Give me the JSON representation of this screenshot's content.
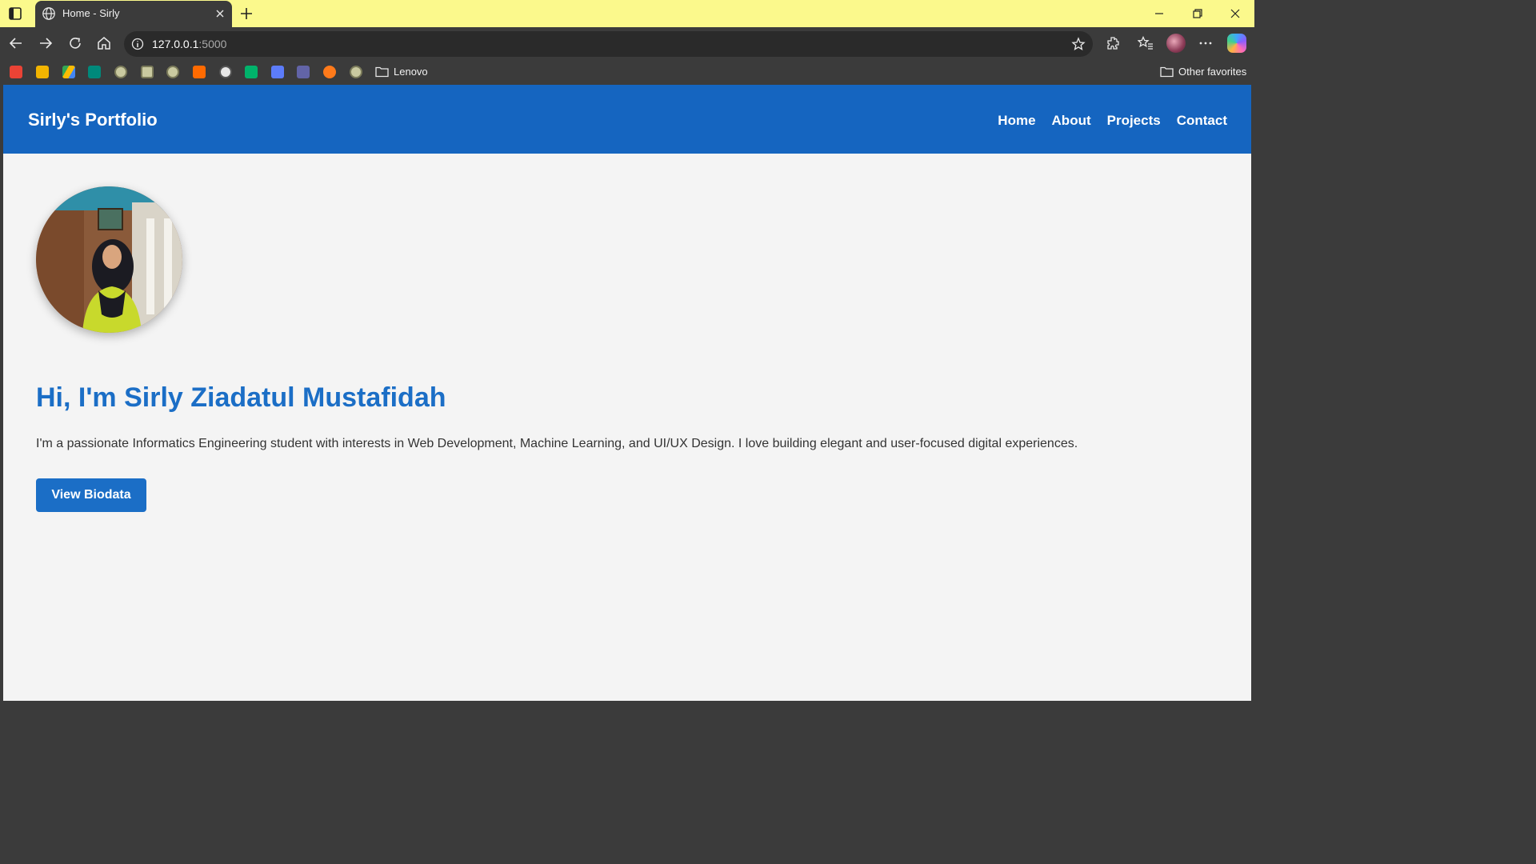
{
  "browser": {
    "tab": {
      "title": "Home - Sirly",
      "icon": "globe-icon"
    },
    "address": {
      "url_host": "127.0.0.1",
      "url_port": ":5000"
    },
    "favorites": {
      "items": [
        {
          "name": "gmail",
          "color": "#ea4335"
        },
        {
          "name": "google-classroom",
          "color": "#f2b400"
        },
        {
          "name": "google-drive",
          "color": "#34a853"
        },
        {
          "name": "google-meet",
          "color": "#00897b"
        },
        {
          "name": "site-a",
          "color": "#c9c9a0"
        },
        {
          "name": "site-b",
          "color": "#c9c9a0"
        },
        {
          "name": "site-c",
          "color": "#c9c9a0"
        },
        {
          "name": "site-d",
          "color": "#ff6a00"
        },
        {
          "name": "openai",
          "color": "#e8e8e8"
        },
        {
          "name": "site-w",
          "color": "#00b36b"
        },
        {
          "name": "google-forms",
          "color": "#5c7cfa"
        },
        {
          "name": "teams",
          "color": "#6264a7"
        },
        {
          "name": "site-h",
          "color": "#ff7a1a"
        },
        {
          "name": "site-e",
          "color": "#c9c9a0"
        }
      ],
      "folder_label": "Lenovo",
      "other_label": "Other favorites"
    }
  },
  "site": {
    "brand": "Sirly's Portfolio",
    "nav": [
      "Home",
      "About",
      "Projects",
      "Contact"
    ],
    "hero": {
      "title": "Hi, I'm Sirly Ziadatul Mustafidah",
      "description": "I'm a passionate Informatics Engineering student with interests in Web Development, Machine Learning, and UI/UX Design. I love building elegant and user-focused digital experiences.",
      "button": "View Biodata"
    }
  },
  "colors": {
    "titlebar": "#fbf98c",
    "header": "#1565c0",
    "accent": "#1b6ec6",
    "page_bg": "#f4f4f4"
  }
}
